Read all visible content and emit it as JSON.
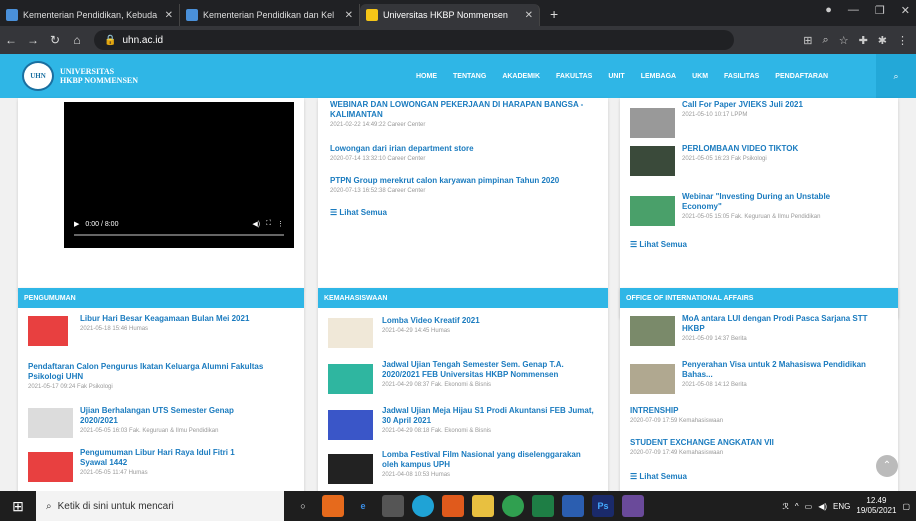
{
  "browser": {
    "tabs": [
      "Kementerian Pendidikan, Kebuda",
      "Kementerian Pendidikan dan Kel",
      "Universitas HKBP Nommensen"
    ],
    "url": "uhn.ac.id"
  },
  "site": {
    "logo_line1": "UNIVERSITAS",
    "logo_line2": "HKBP NOMMENSEN",
    "menu": [
      "HOME",
      "TENTANG",
      "AKADEMIK",
      "FAKULTAS",
      "UNIT",
      "LEMBAGA",
      "UKM",
      "FASILITAS",
      "PENDAFTARAN"
    ]
  },
  "video": {
    "time": "0:00 / 8:00"
  },
  "career": {
    "items": [
      {
        "title": "WEBINAR DAN LOWONGAN PEKERJAAN DI HARAPAN BANGSA - KALIMANTAN",
        "meta": "2021-02-22 14:49:22  Career Center"
      },
      {
        "title": "Lowongan dari irian department store",
        "meta": "2020-07-14 13:32:10  Career Center"
      },
      {
        "title": "PTPN Group merekrut calon karyawan pimpinan Tahun 2020",
        "meta": "2020-07-13 16:52:38  Career Center"
      }
    ],
    "more": "Lihat Semua"
  },
  "news": {
    "items": [
      {
        "title": "Call For Paper JVIEKS Juli 2021",
        "meta": "2021-05-10 10:17  LPPM"
      },
      {
        "title": "PERLOMBAAN VIDEO TIKTOK",
        "meta": "2021-05-05 16:23  Fak Psikologi"
      },
      {
        "title": "Webinar \"Investing During an Unstable Economy\"",
        "meta": "2021-05-05 15:05  Fak. Keguruan & Ilmu Pendidikan"
      }
    ],
    "more": "Lihat Semua"
  },
  "pengumuman": {
    "header": "PENGUMUMAN",
    "items": [
      {
        "title": "Libur Hari Besar Keagamaan Bulan Mei 2021",
        "meta": "2021-05-18 15:46  Humas"
      },
      {
        "title": "Pendaftaran Calon Pengurus Ikatan Keluarga Alumni Fakultas Psikologi UHN",
        "meta": "2021-05-17 09:24  Fak Psikologi"
      },
      {
        "title": "Ujian Berhalangan UTS Semester Genap 2020/2021",
        "meta": "2021-05-05 16:03  Fak. Keguruan & Ilmu Pendidikan"
      },
      {
        "title": "Pengumuman Libur Hari Raya Idul Fitri 1 Syawal 1442",
        "meta": "2021-05-05 11:47  Humas"
      }
    ]
  },
  "kemahasiswaan": {
    "header": "KEMAHASISWAAN",
    "items": [
      {
        "title": "Lomba Video Kreatif 2021",
        "meta": "2021-04-29 14:45  Humas"
      },
      {
        "title": "Jadwal Ujian Tengah Semester Sem. Genap T.A. 2020/2021 FEB Universitas HKBP Nommensen",
        "meta": "2021-04-29 08:37  Fak. Ekonomi & Bisnis"
      },
      {
        "title": "Jadwal Ujian Meja Hijau S1 Prodi Akuntansi FEB Jumat, 30 April 2021",
        "meta": "2021-04-29 08:18  Fak. Ekonomi & Bisnis"
      },
      {
        "title": "Lomba Festival Film Nasional yang diselenggarakan oleh kampus UPH",
        "meta": "2021-04-08 10:53  Humas"
      }
    ]
  },
  "oia": {
    "header": "OFFICE OF INTERNATIONAL AFFAIRS",
    "items": [
      {
        "title": "MoA antara LUI dengan Prodi Pasca Sarjana STT HKBP",
        "meta": "2021-05-09 14:37  Berita"
      },
      {
        "title": "Penyerahan Visa untuk 2 Mahasiswa Pendidikan Bahas...",
        "meta": "2021-05-08 14:12  Berita"
      },
      {
        "title": "INTRENSHIP",
        "meta": "2020-07-09 17:59  Kemahasiswaan"
      },
      {
        "title": "STUDENT EXCHANGE ANGKATAN VII",
        "meta": "2020-07-09 17:49  Kemahasiswaan"
      }
    ],
    "more": "Lihat Semua"
  },
  "taskbar": {
    "search": "Ketik di sini untuk mencari",
    "lang": "ENG",
    "time": "12.49",
    "date": "19/05/2021"
  }
}
